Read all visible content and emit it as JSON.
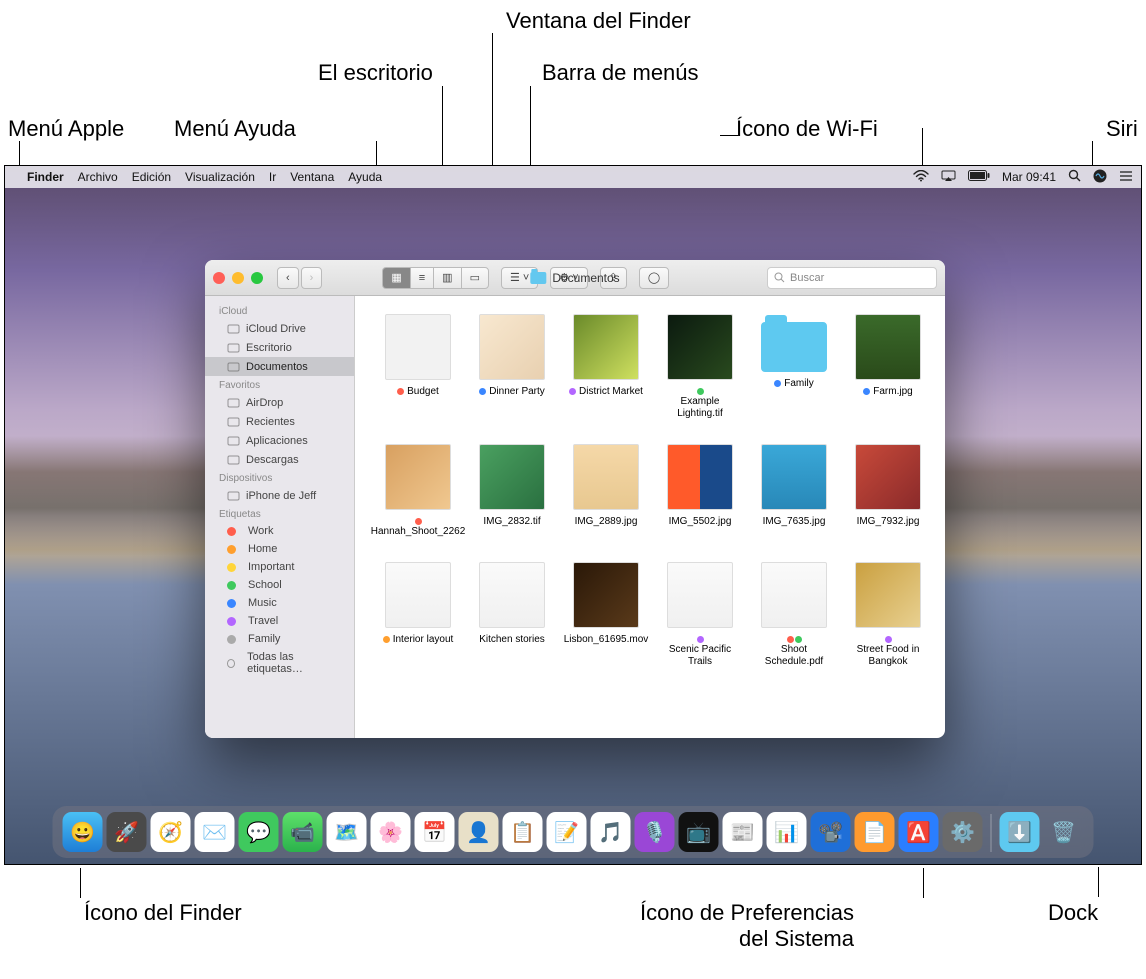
{
  "callouts": {
    "apple_menu": "Menú Apple",
    "help_menu": "Menú Ayuda",
    "desktop": "El escritorio",
    "finder_window": "Ventana del Finder",
    "menubar": "Barra de menús",
    "wifi_icon": "Ícono de Wi-Fi",
    "siri": "Siri",
    "finder_icon": "Ícono del Finder",
    "syspref_icon": "Ícono de Preferencias\ndel Sistema",
    "syspref_icon_l1": "Ícono de Preferencias",
    "syspref_icon_l2": "del Sistema",
    "dock": "Dock"
  },
  "menubar": {
    "app": "Finder",
    "items": [
      "Archivo",
      "Edición",
      "Visualización",
      "Ir",
      "Ventana",
      "Ayuda"
    ],
    "clock": "Mar 09:41"
  },
  "finder": {
    "title": "Documentos",
    "search_placeholder": "Buscar",
    "sidebar": {
      "sections": [
        {
          "header": "iCloud",
          "items": [
            {
              "label": "iCloud Drive"
            },
            {
              "label": "Escritorio"
            },
            {
              "label": "Documentos",
              "selected": true
            }
          ]
        },
        {
          "header": "Favoritos",
          "items": [
            {
              "label": "AirDrop"
            },
            {
              "label": "Recientes"
            },
            {
              "label": "Aplicaciones"
            },
            {
              "label": "Descargas"
            }
          ]
        },
        {
          "header": "Dispositivos",
          "items": [
            {
              "label": "iPhone de Jeff"
            }
          ]
        },
        {
          "header": "Etiquetas",
          "items": [
            {
              "label": "Work",
              "color": "#ff5e4c"
            },
            {
              "label": "Home",
              "color": "#ff9f2e"
            },
            {
              "label": "Important",
              "color": "#ffd53a"
            },
            {
              "label": "School",
              "color": "#3fc95e"
            },
            {
              "label": "Music",
              "color": "#3a86ff"
            },
            {
              "label": "Travel",
              "color": "#b366ff"
            },
            {
              "label": "Family",
              "color": "#aaaaaa"
            },
            {
              "label": "Todas las etiquetas…",
              "all": true
            }
          ]
        }
      ]
    },
    "files": [
      {
        "name": "Budget",
        "tags": [
          "#ff5e4c"
        ],
        "bg": "linear-gradient(#f2f2f2,#f2f2f2)"
      },
      {
        "name": "Dinner Party",
        "tags": [
          "#3a86ff"
        ],
        "bg": "linear-gradient(135deg,#f8e8d0,#e8d0b0)"
      },
      {
        "name": "District Market",
        "tags": [
          "#b366ff"
        ],
        "bg": "linear-gradient(135deg,#6a8a2a,#cfe060)"
      },
      {
        "name": "Example Lighting.tif",
        "tags": [
          "#3fc95e"
        ],
        "bg": "linear-gradient(135deg,#0b1a0f,#294a1e)"
      },
      {
        "name": "Family",
        "folder": true,
        "tags": [
          "#3a86ff"
        ]
      },
      {
        "name": "Farm.jpg",
        "tags": [
          "#3a86ff"
        ],
        "bg": "linear-gradient(180deg,#3a6a2a,#2a4a1a)"
      },
      {
        "name": "Hannah_Shoot_2262",
        "tags": [
          "#ff5e4c"
        ],
        "bg": "linear-gradient(135deg,#d8a060,#f0c890)"
      },
      {
        "name": "IMG_2832.tif",
        "bg": "linear-gradient(135deg,#4aa060,#2a7040)"
      },
      {
        "name": "IMG_2889.jpg",
        "bg": "linear-gradient(180deg,#f5d8a8,#e8c890)"
      },
      {
        "name": "IMG_5502.jpg",
        "bg": "linear-gradient(90deg,#ff5a2a 50%,#1a4a8a 50%)"
      },
      {
        "name": "IMG_7635.jpg",
        "bg": "linear-gradient(180deg,#3aa8d8,#2888b8)"
      },
      {
        "name": "IMG_7932.jpg",
        "bg": "linear-gradient(135deg,#c84a3a,#8a2a2a)"
      },
      {
        "name": "Interior layout",
        "tags": [
          "#ff9f2e"
        ],
        "bg": "linear-gradient(#fafafa,#f0f0f0)"
      },
      {
        "name": "Kitchen stories",
        "bg": "linear-gradient(#fafafa,#f0f0f0)"
      },
      {
        "name": "Lisbon_61695.mov",
        "bg": "linear-gradient(135deg,#2a1808,#5a3a1a)"
      },
      {
        "name": "Scenic Pacific Trails",
        "tags": [
          "#b366ff"
        ],
        "bg": "linear-gradient(#fafafa,#f0f0f0)"
      },
      {
        "name": "Shoot Schedule.pdf",
        "tags": [
          "#ff5e4c",
          "#3fc95e"
        ],
        "bg": "linear-gradient(#fafafa,#f0f0f0)"
      },
      {
        "name": "Street Food in Bangkok",
        "tags": [
          "#b366ff"
        ],
        "bg": "linear-gradient(135deg,#caa040,#e8d090)"
      }
    ]
  },
  "dock": [
    {
      "name": "finder",
      "bg": "linear-gradient(180deg,#4ac0f5,#1e7ed6)",
      "glyph": "😀"
    },
    {
      "name": "launchpad",
      "bg": "#4a4a4a",
      "glyph": "🚀"
    },
    {
      "name": "safari",
      "bg": "#fff",
      "glyph": "🧭"
    },
    {
      "name": "mail",
      "bg": "#fff",
      "glyph": "✉️"
    },
    {
      "name": "messages",
      "bg": "#3fc95e",
      "glyph": "💬"
    },
    {
      "name": "facetime",
      "bg": "linear-gradient(#5de06a,#2bb24c)",
      "glyph": "📹"
    },
    {
      "name": "maps",
      "bg": "#fff",
      "glyph": "🗺️"
    },
    {
      "name": "photos",
      "bg": "#fff",
      "glyph": "🌸"
    },
    {
      "name": "calendar",
      "bg": "#fff",
      "glyph": "📅"
    },
    {
      "name": "contacts",
      "bg": "#e8e0c8",
      "glyph": "👤"
    },
    {
      "name": "reminders",
      "bg": "#fff",
      "glyph": "📋"
    },
    {
      "name": "notes",
      "bg": "#fff",
      "glyph": "📝"
    },
    {
      "name": "music",
      "bg": "#fff",
      "glyph": "🎵"
    },
    {
      "name": "podcasts",
      "bg": "#9a47d6",
      "glyph": "🎙️"
    },
    {
      "name": "tv",
      "bg": "#111",
      "glyph": "📺"
    },
    {
      "name": "news",
      "bg": "#fff",
      "glyph": "📰"
    },
    {
      "name": "numbers",
      "bg": "#fff",
      "glyph": "📊"
    },
    {
      "name": "keynote",
      "bg": "#1f6fd8",
      "glyph": "📽️"
    },
    {
      "name": "pages",
      "bg": "#ff9a2e",
      "glyph": "📄"
    },
    {
      "name": "appstore",
      "bg": "#2a7eff",
      "glyph": "🅰️"
    },
    {
      "name": "systempreferences",
      "bg": "#6a6a6a",
      "glyph": "⚙️"
    }
  ],
  "dock_right": [
    {
      "name": "downloads",
      "bg": "#5ec9f0",
      "glyph": "⬇️"
    },
    {
      "name": "trash",
      "bg": "transparent",
      "glyph": "🗑️"
    }
  ]
}
